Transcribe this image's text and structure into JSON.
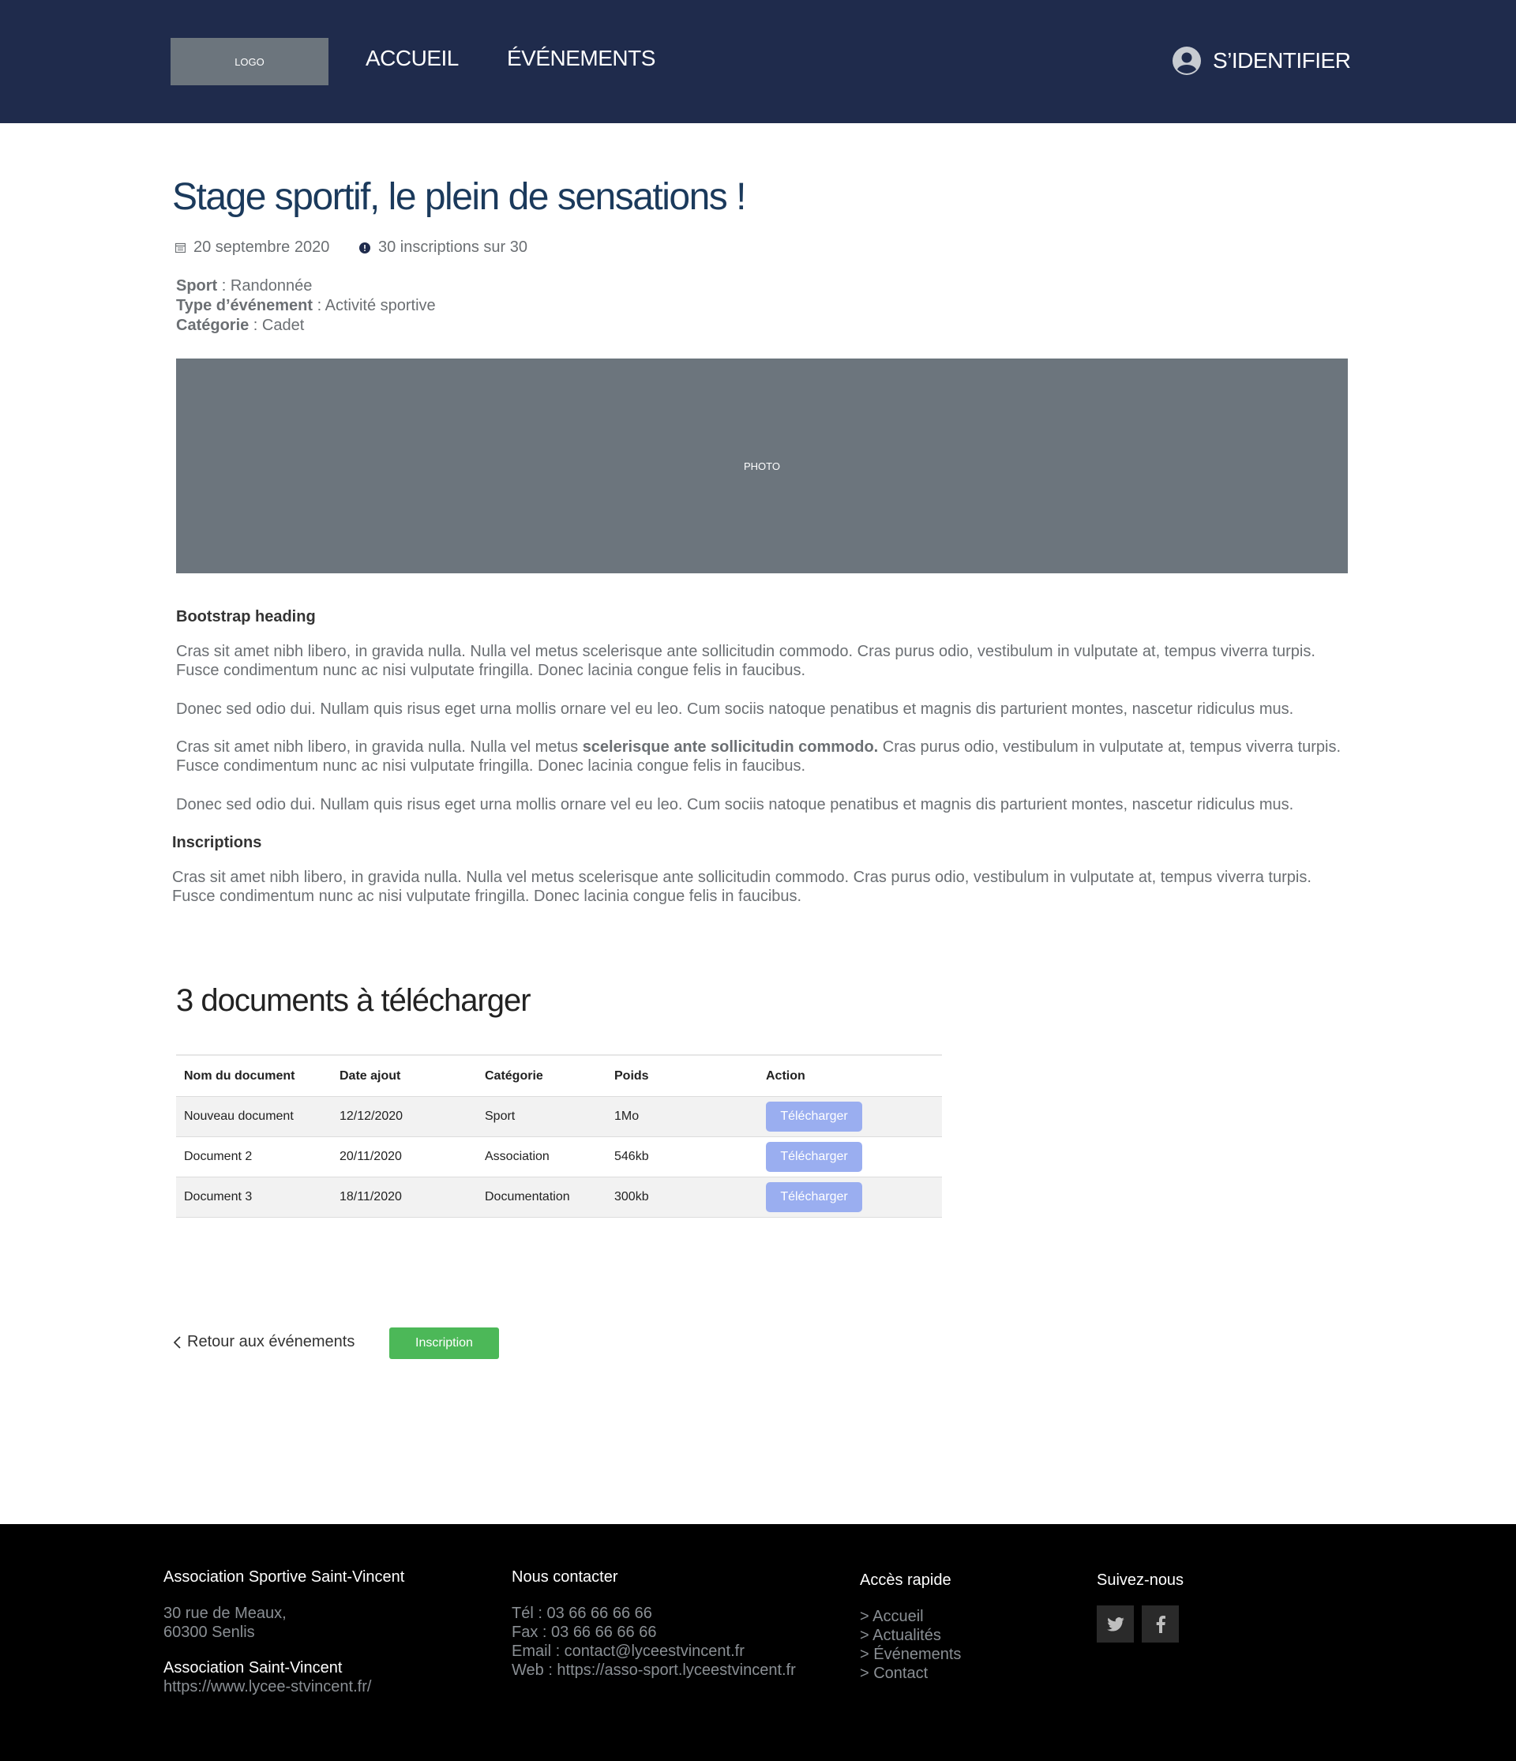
{
  "header": {
    "logo": "LOGO",
    "nav": {
      "accueil": "ACCUEIL",
      "evenements": "ÉVÉNEMENTS"
    },
    "login": "S’IDENTIFIER"
  },
  "event": {
    "title": "Stage sportif, le plein de sensations !",
    "date": "20 septembre 2020",
    "inscriptions": "30 inscriptions sur 30",
    "sport_label": "Sport",
    "sport_value": " : Randonnée",
    "type_label": "Type d’événement",
    "type_value": " : Activité sportive",
    "categorie_label": "Catégorie",
    "categorie_value": " : Cadet",
    "photo": "PHOTO"
  },
  "content": {
    "heading": "Bootstrap heading",
    "p1": "Cras sit amet nibh libero, in gravida nulla. Nulla vel metus scelerisque ante sollicitudin commodo. Cras purus odio, vestibulum in vulputate at, tempus viverra turpis. Fusce condimentum nunc ac nisi vulputate fringilla. Donec lacinia congue felis in faucibus.",
    "p2": "Donec sed odio dui. Nullam quis risus eget urna mollis ornare vel eu leo. Cum sociis natoque penatibus et magnis dis parturient montes, nascetur ridiculus mus.",
    "p3_start": "Cras sit amet nibh libero, in gravida nulla. Nulla vel metus ",
    "p3_bold": "scelerisque ante sollicitudin commodo.",
    "p3_end": " Cras purus odio, vestibulum in vulputate at, tempus viverra turpis. Fusce condimentum nunc ac nisi vulputate fringilla. Donec lacinia congue felis in faucibus.",
    "p4": "Donec sed odio dui. Nullam quis risus eget urna mollis ornare vel eu leo. Cum sociis natoque penatibus et magnis dis parturient montes, nascetur ridiculus mus.",
    "inscriptions_heading": "Inscriptions",
    "p5": "Cras sit amet nibh libero, in gravida nulla. Nulla vel metus scelerisque ante sollicitudin commodo. Cras purus odio, vestibulum in vulputate at, tempus viverra turpis. Fusce condimentum nunc ac nisi vulputate fringilla. Donec lacinia congue felis in faucibus."
  },
  "documents": {
    "title": "3 documents à télécharger",
    "headers": [
      "Nom du document",
      "Date ajout",
      "Catégorie",
      "Poids",
      "Action"
    ],
    "rows": [
      {
        "name": "Nouveau document",
        "date": "12/12/2020",
        "category": "Sport",
        "size": "1Mo",
        "action": "Télécharger"
      },
      {
        "name": "Document 2",
        "date": "20/11/2020",
        "category": "Association",
        "size": "546kb",
        "action": "Télécharger"
      },
      {
        "name": "Document 3",
        "date": "18/11/2020",
        "category": "Documentation",
        "size": "300kb",
        "action": "Télécharger"
      }
    ]
  },
  "actions": {
    "back": "Retour aux événements",
    "inscription": "Inscription"
  },
  "footer": {
    "col1": {
      "title": "Association Sportive Saint-Vincent",
      "address1": "30 rue de Meaux,",
      "address2": "60300 Senlis",
      "name": "Association Saint-Vincent",
      "url": "https://www.lycee-stvincent.fr/"
    },
    "col2": {
      "title": "Nous contacter",
      "tel": "Tél : 03 66 66 66 66",
      "fax": "Fax : 03 66 66 66 66",
      "email": "Email : contact@lyceestvincent.fr",
      "web": "Web : https://asso-sport.lyceestvincent.fr"
    },
    "col3": {
      "title": "Accès rapide",
      "links": [
        "> Accueil",
        "> Actualités",
        "> Événements",
        "> Contact"
      ]
    },
    "col4": {
      "title": "Suivez-nous"
    }
  },
  "colors": {
    "header_bg": "#1f2b4c",
    "title": "#1b3a5c",
    "download_btn": "#9aaef0",
    "inscription_btn": "#4cb858",
    "footer_bg": "#000000"
  },
  "icons": [
    "user-circle-icon",
    "calendar-icon",
    "info-icon",
    "chevron-left-icon",
    "twitter-icon",
    "facebook-icon"
  ]
}
